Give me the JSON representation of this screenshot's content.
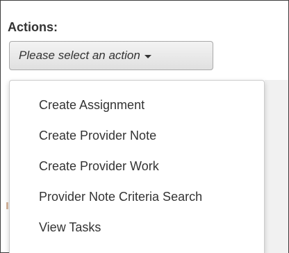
{
  "actions": {
    "label": "Actions:",
    "select_placeholder": "Please select an action"
  },
  "menu": {
    "items": [
      {
        "label": "Create Assignment"
      },
      {
        "label": "Create Provider Note"
      },
      {
        "label": "Create Provider Work"
      },
      {
        "label": "Provider Note Criteria Search"
      },
      {
        "label": "View Tasks"
      }
    ]
  },
  "icons": {
    "dropdown": "caret-down-icon"
  }
}
